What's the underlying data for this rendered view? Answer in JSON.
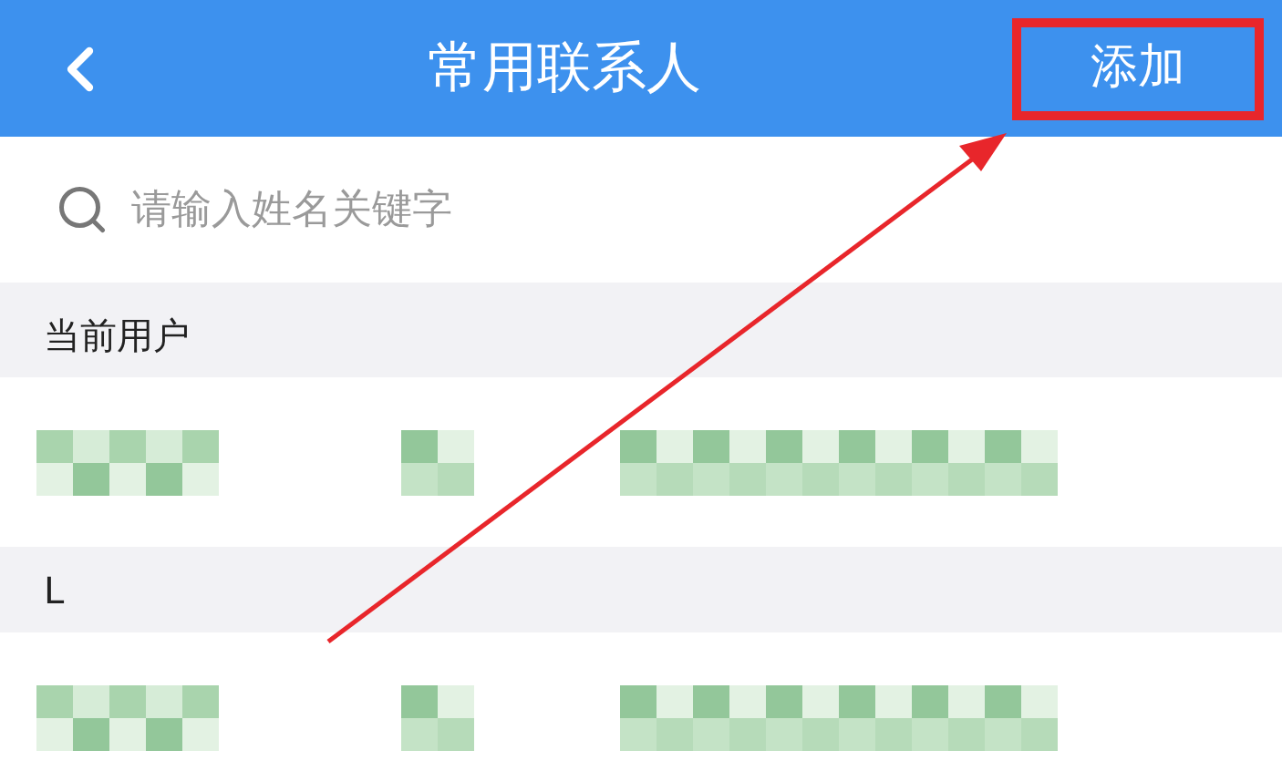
{
  "header": {
    "title": "常用联系人",
    "add_button": {
      "label": "添加",
      "highlighted": true
    }
  },
  "search": {
    "placeholder": "请输入姓名关键字"
  },
  "sections": [
    {
      "title": "当前用户",
      "rows": [
        {
          "kind": "redacted"
        }
      ]
    },
    {
      "title": "L",
      "rows": [
        {
          "kind": "redacted"
        }
      ]
    }
  ],
  "annotation_arrow": true
}
